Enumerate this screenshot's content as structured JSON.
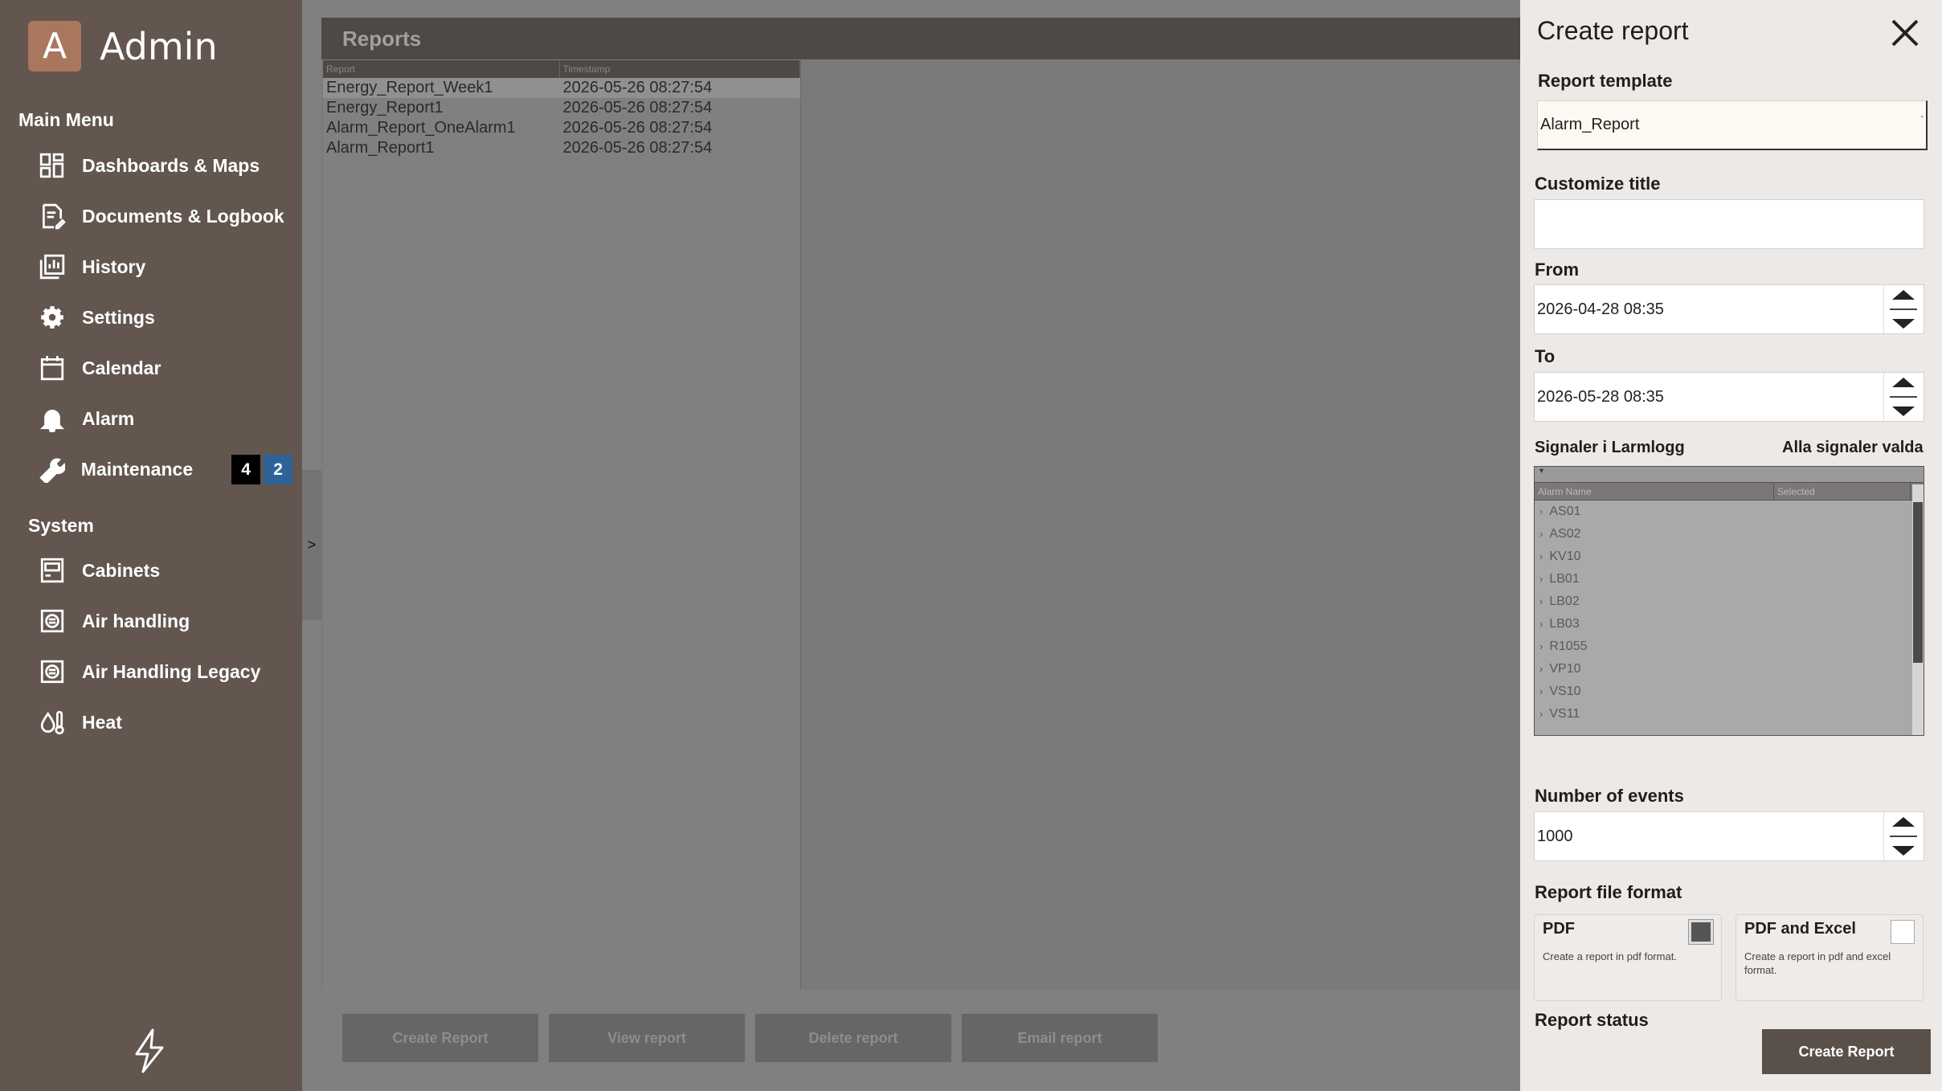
{
  "app": {
    "logo_letter": "A",
    "title": "Admin"
  },
  "sidebar": {
    "main_menu_title": "Main Menu",
    "main_items": [
      {
        "label": "Dashboards & Maps",
        "icon": "dashboard-icon"
      },
      {
        "label": "Documents & Logbook",
        "icon": "document-icon"
      },
      {
        "label": "History",
        "icon": "history-icon"
      },
      {
        "label": "Settings",
        "icon": "gear-icon"
      },
      {
        "label": "Calendar",
        "icon": "calendar-icon"
      },
      {
        "label": "Alarm",
        "icon": "bell-icon"
      },
      {
        "label": "Maintenance",
        "icon": "wrench-icon"
      }
    ],
    "maintenance_badges": [
      "4",
      "2"
    ],
    "system_title": "System",
    "system_items": [
      {
        "label": "Cabinets",
        "icon": "cabinet-icon"
      },
      {
        "label": "Air handling",
        "icon": "air-handling-icon"
      },
      {
        "label": "Air Handling Legacy",
        "icon": "air-handling-legacy-icon"
      },
      {
        "label": "Heat",
        "icon": "heat-icon"
      }
    ],
    "collapse_label": ">"
  },
  "reports": {
    "title": "Reports",
    "columns": [
      "Report",
      "Timestamp"
    ],
    "rows": [
      [
        "Energy_Report_Week1",
        "2026-05-26 08:27:54"
      ],
      [
        "Energy_Report1",
        "2026-05-26 08:27:54"
      ],
      [
        "Alarm_Report_OneAlarm1",
        "2026-05-26 08:27:54"
      ],
      [
        "Alarm_Report1",
        "2026-05-26 08:27:54"
      ]
    ],
    "buttons": [
      "Create Report",
      "View report",
      "Delete report",
      "Email report"
    ]
  },
  "drawer": {
    "title": "Create report",
    "template_label": "Report template",
    "template_value": "Alarm_Report",
    "select_caret": "-",
    "title_label": "Customize title",
    "title_value": "",
    "from_label": "From",
    "from_value": "2026-04-28 08:35",
    "to_label": "To",
    "to_value": "2026-05-28 08:35",
    "signals_label": "Signaler i Larmlogg",
    "signals_status": "Alla signaler valda",
    "filter_caret": "▾",
    "signal_columns": [
      "Alarm Name",
      "Selected"
    ],
    "signals": [
      "AS01",
      "AS02",
      "KV10",
      "LB01",
      "LB02",
      "LB03",
      "R1055",
      "VP10",
      "VS10",
      "VS11"
    ],
    "events_label": "Number of events",
    "events_value": "1000",
    "format_label": "Report file format",
    "formats": [
      {
        "title": "PDF",
        "desc": "Create a report in pdf format.",
        "checked": true
      },
      {
        "title": "PDF and Excel",
        "desc": "Create a report in pdf and excel format.",
        "checked": false
      }
    ],
    "status_label": "Report status",
    "create_button": "Create Report"
  },
  "colors": {
    "sidebar_bg": "#62564f",
    "logo_bg": "#a8775e",
    "overlay_bg": "#808080",
    "drawer_bg": "#ece9e6",
    "badge_blue": "#2f6299",
    "primary_button": "#5a504a"
  }
}
